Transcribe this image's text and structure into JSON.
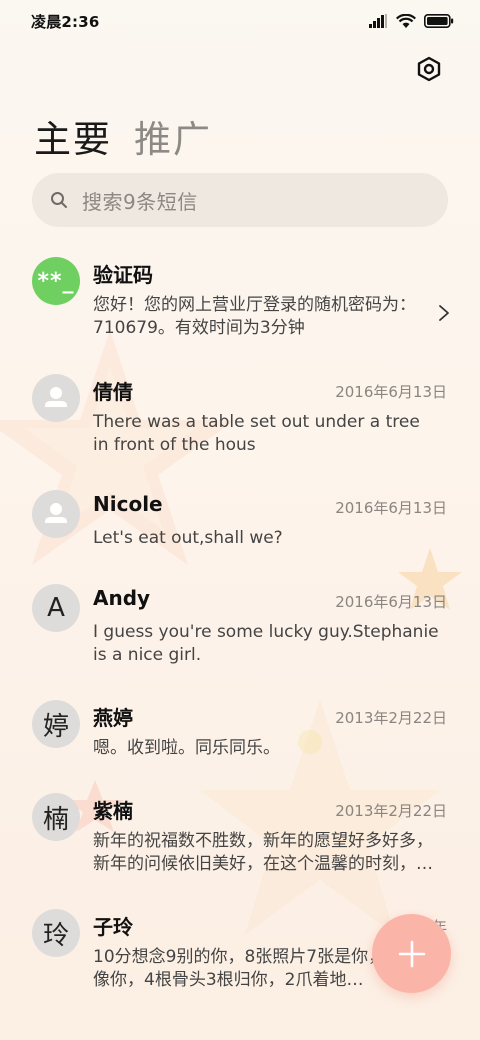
{
  "status_bar": {
    "time": "凌晨2:36"
  },
  "tabs": {
    "primary": "主要",
    "promo": "推广"
  },
  "search": {
    "placeholder": "搜索9条短信"
  },
  "messages": [
    {
      "avatar": "**_",
      "name": "验证码",
      "date": "",
      "preview": "您好！您的网上营业厅登录的随机密码为：710679。有效时间为3分钟"
    },
    {
      "avatar": "person-icon",
      "name": "倩倩",
      "date": "2016年6月13日",
      "preview": "There was a table set out under a tree in front of the hous"
    },
    {
      "avatar": "person-icon",
      "name": "Nicole",
      "date": "2016年6月13日",
      "preview": "Let's eat out,shall we?"
    },
    {
      "avatar": "A",
      "name": "Andy",
      "date": "2016年6月13日",
      "preview": "I guess you're some lucky guy.Stephanie is a nice girl."
    },
    {
      "avatar": "婷",
      "name": "燕婷",
      "date": "2013年2月22日",
      "preview": "嗯。收到啦。同乐同乐。"
    },
    {
      "avatar": "楠",
      "name": "紫楠",
      "date": "2013年2月22日",
      "preview": "新年的祝福数不胜数，新年的愿望好多好多，新年的问候依旧美好，在这个温馨的时刻，…"
    },
    {
      "avatar": "玲",
      "name": "子玲",
      "date": "2013年",
      "preview": "10分想念9别的你，8张照片7张是你，狗5只像你，4根骨头3根归你，2爪着地…"
    }
  ],
  "colors": {
    "verify_avatar": "#6fd061",
    "fab": "#fbb5a8",
    "search_bg": "#efe8e1"
  },
  "icons": {
    "settings": "settings-hex-icon",
    "fab": "plus-icon",
    "search": "search-icon"
  }
}
